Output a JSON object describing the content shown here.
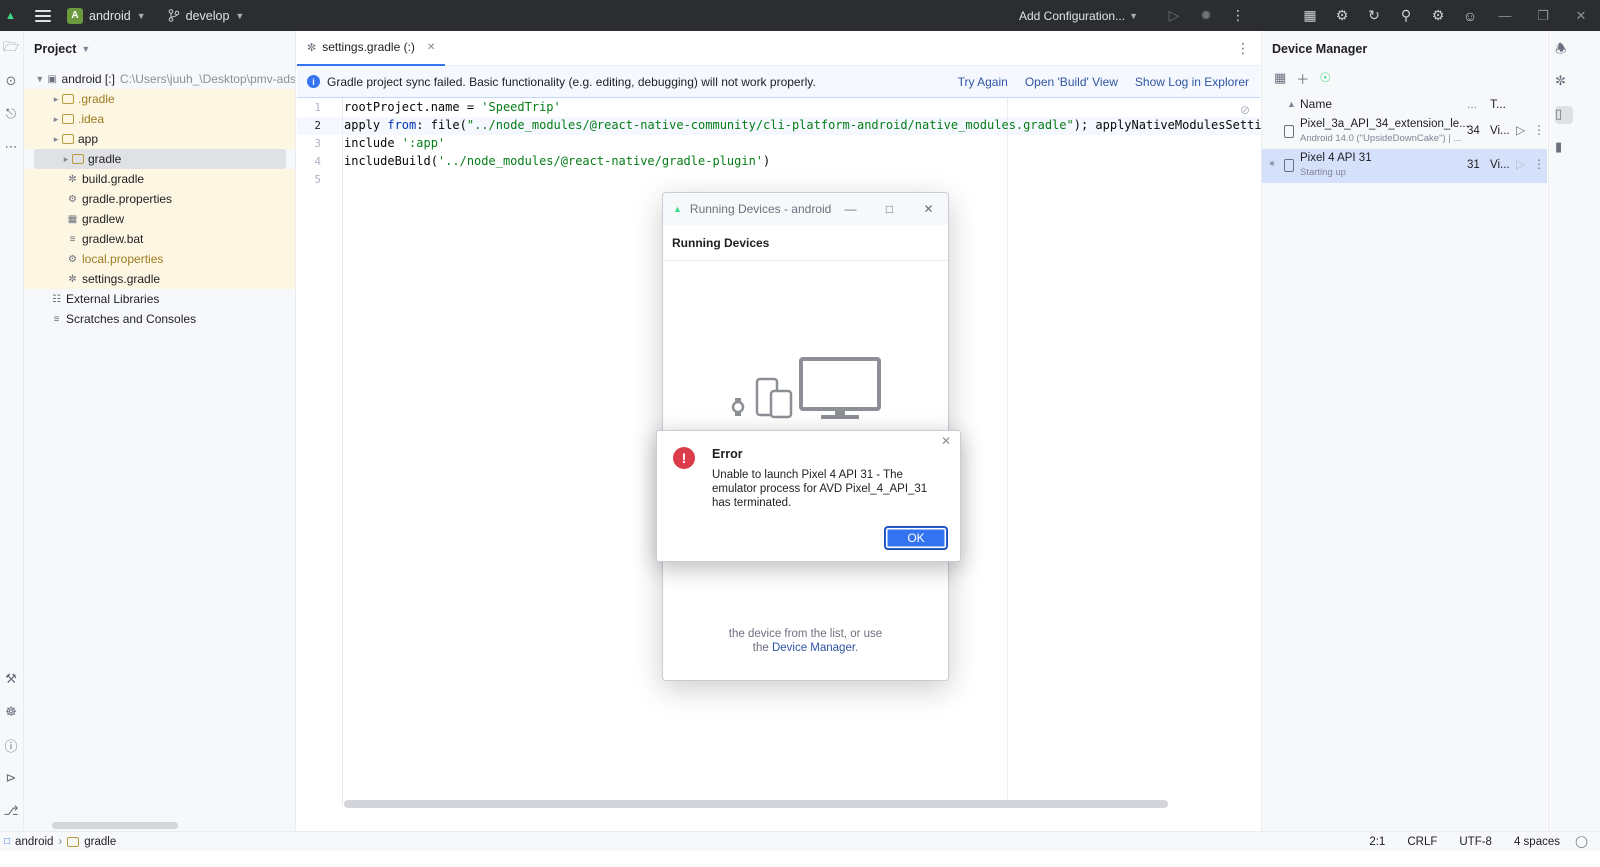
{
  "titlebar": {
    "project_name": "android",
    "project_badge": "A",
    "branch": "develop",
    "run_config": "Add Configuration...",
    "window_controls": [
      "minimize",
      "restore",
      "close"
    ]
  },
  "project_panel": {
    "title": "Project",
    "root": {
      "label": "android [:]",
      "path": "C:\\Users\\juuh_\\Desktop\\pmv-ads"
    },
    "items": [
      {
        "label": ".gradle",
        "kind": "folder"
      },
      {
        "label": ".idea",
        "kind": "folder"
      },
      {
        "label": "app",
        "kind": "folder"
      },
      {
        "label": "gradle",
        "kind": "folder"
      },
      {
        "label": "build.gradle",
        "kind": "gradle-file"
      },
      {
        "label": "gradle.properties",
        "kind": "properties-file"
      },
      {
        "label": "gradlew",
        "kind": "script-file"
      },
      {
        "label": "gradlew.bat",
        "kind": "text-file"
      },
      {
        "label": "local.properties",
        "kind": "properties-file"
      },
      {
        "label": "settings.gradle",
        "kind": "gradle-file"
      }
    ],
    "external_libraries": "External Libraries",
    "scratches": "Scratches and Consoles"
  },
  "editor": {
    "tab_label": "settings.gradle (:)",
    "notification": {
      "message": "Gradle project sync failed. Basic functionality (e.g. editing, debugging) will not work properly.",
      "links": [
        "Try Again",
        "Open 'Build' View",
        "Show Log in Explorer"
      ]
    },
    "line_numbers": [
      "1",
      "2",
      "3",
      "4",
      "5"
    ],
    "code": {
      "l1_a": "rootProject.name = ",
      "l1_b": "'SpeedTrip'",
      "l2_a": "apply ",
      "l2_b": "from",
      "l2_c": ": file(",
      "l2_d": "\"../node_modules/@react-native-community/cli-platform-android/native_modules.gradle\"",
      "l2_e": "); applyNativeModulesSettingsGradle(se",
      "l3_a": "include ",
      "l3_b": "':app'",
      "l4_a": "includeBuild(",
      "l4_b": "'../node_modules/@react-native/gradle-plugin'",
      "l4_c": ")"
    }
  },
  "device_manager": {
    "title": "Device Manager",
    "columns": {
      "name": "Name",
      "api": "...",
      "type": "T..."
    },
    "devices": [
      {
        "name": "Pixel_3a_API_34_extension_le...",
        "subtitle": "Android 14.0 (\"UpsideDownCake\") | ...",
        "api": "34",
        "type": "Vi..."
      },
      {
        "name": "Pixel 4 API 31",
        "subtitle": "Starting up",
        "api": "31",
        "type": "Vi..."
      }
    ]
  },
  "running_devices_window": {
    "title": "Running Devices - android",
    "header": "Running Devices",
    "hint_line1": "the device from the list, or use",
    "hint_prefix": "the ",
    "hint_link": "Device Manager",
    "hint_suffix": "."
  },
  "error_dialog": {
    "title": "Error",
    "message": "Unable to launch Pixel 4 API 31 - The emulator process for AVD Pixel_4_API_31 has terminated.",
    "ok_label": "OK",
    "icon": "!"
  },
  "statusbar": {
    "crumb_root": "android",
    "crumb_child": "gradle",
    "position": "2:1",
    "line_sep": "CRLF",
    "encoding": "UTF-8",
    "indent": "4 spaces"
  },
  "colors": {
    "accent": "#3574f0",
    "error": "#db3b4b",
    "titlebar_bg": "#2b2d30",
    "string": "#067d17",
    "keyword": "#0033b3"
  }
}
